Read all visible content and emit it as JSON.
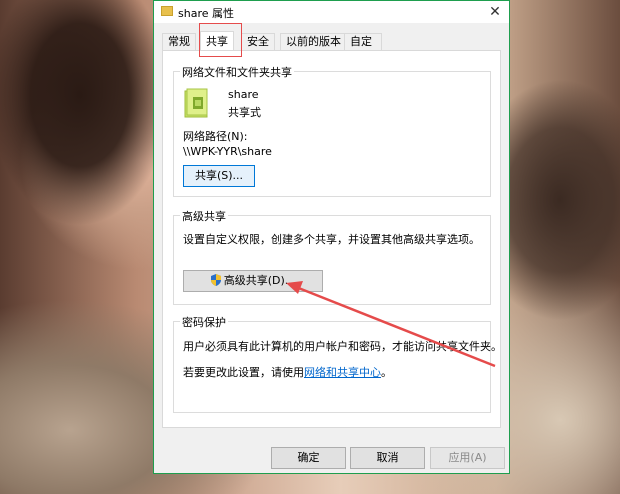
{
  "window": {
    "title": "share 属性",
    "close_glyph": "✕"
  },
  "tabs": [
    {
      "label": "常规"
    },
    {
      "label": "共享"
    },
    {
      "label": "安全"
    },
    {
      "label": "以前的版本"
    },
    {
      "label": "自定义"
    }
  ],
  "network_share": {
    "group_title": "网络文件和文件夹共享",
    "folder_name": "share",
    "folder_status": "共享式",
    "path_label": "网络路径(N):",
    "path_value": "\\\\WPK-YYR\\share",
    "share_button": "共享(S)..."
  },
  "advanced": {
    "group_title": "高级共享",
    "description": "设置自定义权限，创建多个共享，并设置其他高级共享选项。",
    "button": "高级共享(D)..."
  },
  "password": {
    "group_title": "密码保护",
    "line1": "用户必须具有此计算机的用户帐户和密码，才能访问共享文件夹。",
    "line2_prefix": "若要更改此设置，请使用",
    "line2_link": "网络和共享中心",
    "line2_suffix": "。"
  },
  "footer": {
    "ok": "确定",
    "cancel": "取消",
    "apply": "应用(A)"
  },
  "colors": {
    "window_border": "#1e9e4e",
    "annotation": "#e54b4b",
    "link": "#0066cc"
  },
  "icons": {
    "title": "folder-icon",
    "share_folder": "shared-folder-icon",
    "advanced_button": "uac-shield-icon"
  }
}
